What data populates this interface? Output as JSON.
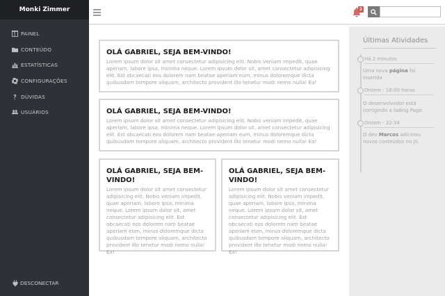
{
  "sidebar": {
    "brand": "Monki Zimmer",
    "items": [
      {
        "label": "PAINEL",
        "icon": "panel-icon"
      },
      {
        "label": "CONTEÚDO",
        "icon": "folder-icon"
      },
      {
        "label": "ESTATÍSTICAS",
        "icon": "chart-icon"
      },
      {
        "label": "CONFIGURAÇÕES",
        "icon": "gear-icon"
      },
      {
        "label": "DÚVIDAS",
        "icon": "question-icon"
      },
      {
        "label": "USUÁRIOS",
        "icon": "users-icon"
      }
    ],
    "disconnect": "DESCONECTAR"
  },
  "topbar": {
    "notifications_count": "2",
    "search_placeholder": ""
  },
  "cards": [
    {
      "title": "OLÁ GABRIEL, SEJA BEM-VINDO!",
      "text": "Lorem ipsum dolor sit amet consectetur adipisicing elit. Nobis veniam impedit, quae aperiam, labore ipsa, minima neque. Lorem ipsum dolor sit, amet consectetur adipisicing elit. Est obcaecati eos dolorem nam beatae aperiam eum, minus doloremque dicta quibusdam tempore aliquam, architecto provident illo tenetur modi nemo nulla! Ea!"
    },
    {
      "title": "OLÁ GABRIEL, SEJA BEM-VINDO!",
      "text": "Lorem ipsum dolor sit amet consectetur adipisicing elit. Nobis veniam impedit, quae aperiam, labore ipsa, minima neque. Lorem ipsum dolor sit, amet consectetur adipisicing elit. Est obcaecati eos dolorem nam beatae aperiam eum, minus doloremque dicta quibusdam tempore aliquam, architecto provident illo tenetur modi nemo nulla! Ea!"
    },
    {
      "title": "OLÁ GABRIEL, SEJA BEM-VINDO!",
      "text": "Lorem ipsum dolor sit amet consectetur adipisicing elit. Nobis veniam impedit, quae aperiam, labore ipsa, minima neque. Lorem ipsum dolor sit, amet consectetur adipisicing elit. Est obcaecati eos dolorem nam beatae aperiam eum, minus doloremque dicta quibusdam tempore aliquam, architecto provident illo tenetur modi nemo nulla! Ea!"
    },
    {
      "title": "OLÁ GABRIEL, SEJA BEM-VINDO!",
      "text": "Lorem ipsum dolor sit amet consectetur adipisicing elit. Nobis veniam impedit, quae aperiam, labore ipsa, minima neque. Lorem ipsum dolor sit, amet consectetur adipisicing elit. Est obcaecati eos dolorem nam beatae aperiam eum, minus doloremque dicta quibusdam tempore aliquam, architecto provident illo tenetur modi nemo nulla! Ea!"
    }
  ],
  "activity": {
    "title": "Últimas Atividades",
    "entries": [
      {
        "time": "Há 2 minutos",
        "text_before": "Uma nova ",
        "highlight": "página",
        "text_after": " foi inserida"
      },
      {
        "time": "Ontem - 18:00 horas",
        "text_before": "O desenvolvedor está corrigindo a lading Page.",
        "highlight": "",
        "text_after": ""
      },
      {
        "time": "Ontem - 22:34",
        "text_before": "O dev ",
        "highlight": "Marcos",
        "text_after": " adicinou novos conteúdos no JS."
      }
    ]
  }
}
